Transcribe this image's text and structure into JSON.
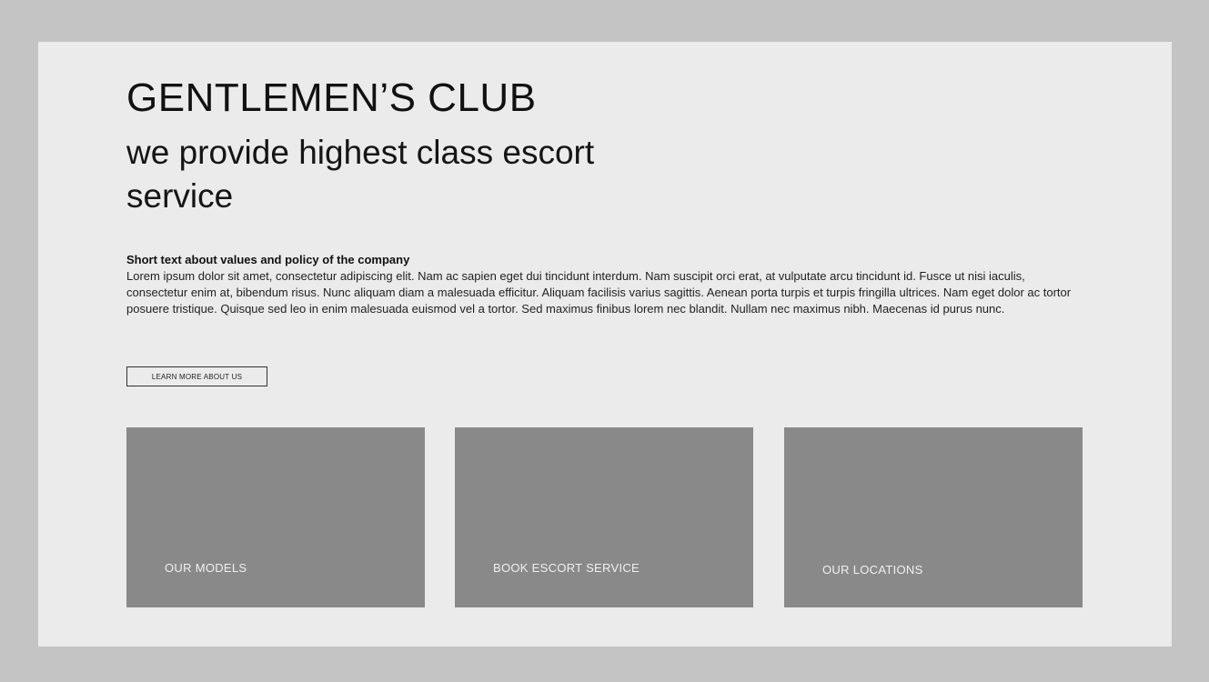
{
  "hero": {
    "title": "GENTLEMEN’S CLUB",
    "subtitle": "we provide highest class escort service"
  },
  "about": {
    "heading": "Short text about values and policy of the company",
    "body": "Lorem ipsum dolor sit amet, consectetur adipiscing elit. Nam ac sapien eget dui tincidunt interdum. Nam suscipit orci erat, at vulputate arcu tincidunt id. Fusce ut nisi iaculis, consectetur enim at, bibendum risus. Nunc aliquam diam a malesuada efficitur. Aliquam facilisis varius sagittis. Aenean porta turpis et turpis fringilla ultrices. Nam eget dolor ac tortor posuere tristique. Quisque sed leo in enim malesuada euismod vel a tortor. Sed maximus finibus lorem nec blandit. Nullam nec maximus nibh. Maecenas id purus nunc.",
    "button_label": "LEARN MORE ABOUT US"
  },
  "cards": [
    {
      "label": "OUR MODELS"
    },
    {
      "label": "BOOK ESCORT SERVICE"
    },
    {
      "label": "OUR LOCATIONS"
    }
  ],
  "colors": {
    "page_background": "#c4c4c4",
    "panel_background": "#ebebeb",
    "card_background": "#898989",
    "card_text": "#f0f0f0",
    "text": "#111111"
  }
}
